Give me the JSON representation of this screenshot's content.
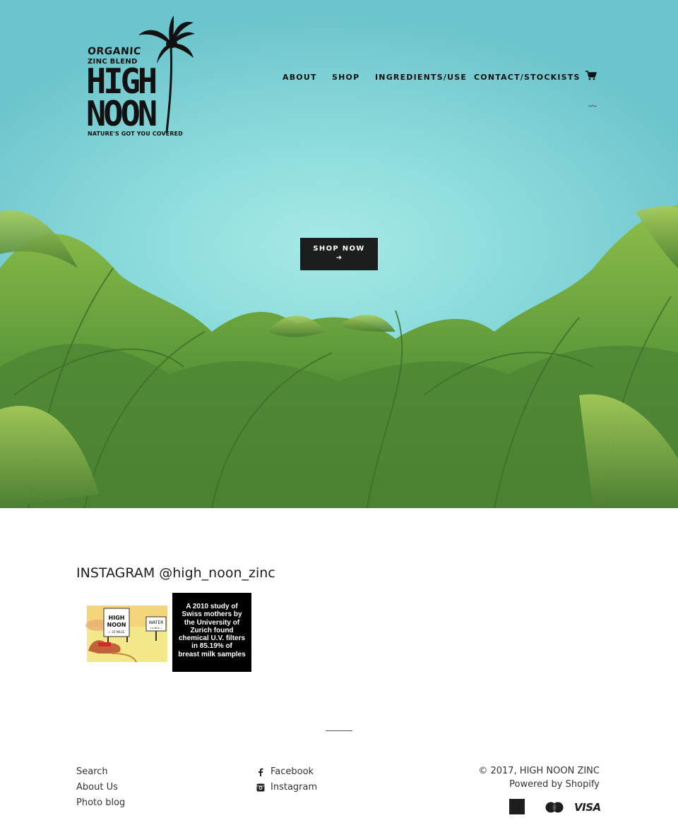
{
  "brand": {
    "logo": {
      "line1": "ORGANIC",
      "line2": "ZINC BLEND",
      "line3": "HIGH",
      "line4": "NOON",
      "tagline": "NATURE'S GOT YOU COVERED"
    }
  },
  "nav": {
    "items": [
      {
        "label": "ABOUT"
      },
      {
        "label": "SHOP"
      },
      {
        "label": "INGREDIENTS/USE"
      },
      {
        "label": "CONTACT/STOCKISTS"
      }
    ],
    "cart_icon": "cart-icon"
  },
  "hero": {
    "cta_label": "SHOP NOW",
    "cta_arrow": "➜"
  },
  "instagram": {
    "title": "INSTAGRAM @high_noon_zinc",
    "posts": [
      {
        "type": "cartoon",
        "sign1_line1": "HIGH",
        "sign1_line2": "NOON",
        "sign1_sub": "← 35 MILES",
        "sign2": "WATER",
        "sign2_sub": "1/4 MILE →"
      },
      {
        "type": "text",
        "lines": [
          "A 2010 study of",
          "Swiss mothers by",
          "the University of",
          "Zurich found",
          "chemical U.V. filters",
          "in 85.19% of",
          "breast milk samples"
        ]
      }
    ]
  },
  "footer": {
    "links": [
      {
        "label": "Search"
      },
      {
        "label": "About Us"
      },
      {
        "label": "Photo blog"
      }
    ],
    "social": [
      {
        "label": "Facebook",
        "icon": "facebook-icon"
      },
      {
        "label": "Instagram",
        "icon": "instagram-icon"
      }
    ],
    "copyright": "© 2017, HIGH NOON ZINC",
    "powered_by": "Powered by Shopify",
    "payments": [
      {
        "name": "American Express",
        "label": "AMERICAN EXPRESS"
      },
      {
        "name": "MasterCard",
        "label": "MasterCard"
      },
      {
        "name": "Visa",
        "label": "VISA"
      }
    ]
  }
}
